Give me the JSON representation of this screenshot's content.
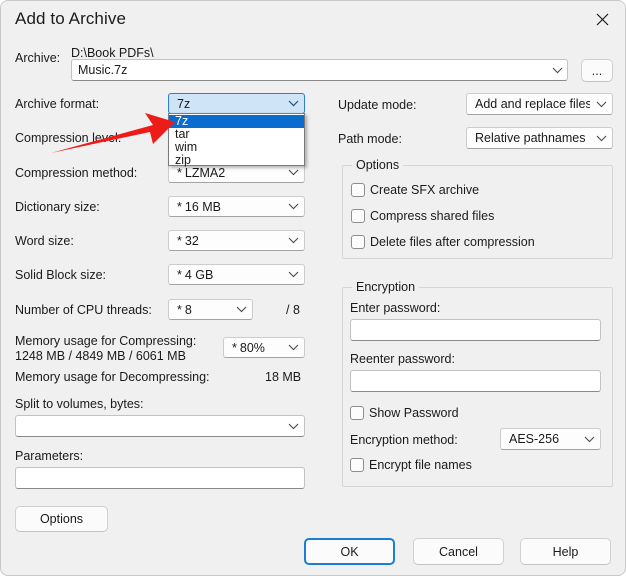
{
  "window": {
    "title": "Add to Archive",
    "close_icon": "close-icon"
  },
  "archive": {
    "label": "Archive:",
    "path": "D:\\Book PDFs\\",
    "filename": "Music.7z",
    "browse_label": "...",
    "dropdown_icon": "chevron-down-icon"
  },
  "left": {
    "archive_format": {
      "label": "Archive format:",
      "value": "7z",
      "open": true,
      "options": [
        "7z",
        "tar",
        "wim",
        "zip"
      ],
      "selected_index": 0
    },
    "compression_level": {
      "label": "Compression level:",
      "value": ""
    },
    "compression_method": {
      "label": "Compression method:",
      "star": "*",
      "value": "LZMA2"
    },
    "dictionary_size": {
      "label": "Dictionary size:",
      "star": "*",
      "value": "16 MB"
    },
    "word_size": {
      "label": "Word size:",
      "star": "*",
      "value": "32"
    },
    "solid_block_size": {
      "label": "Solid Block size:",
      "star": "*",
      "value": "4 GB"
    },
    "cpu_threads": {
      "label": "Number of CPU threads:",
      "star": "*",
      "value": "8",
      "total": "/ 8"
    },
    "memory_compressing": {
      "label": "Memory usage for Compressing:",
      "detail": "1248 MB / 4849 MB / 6061 MB",
      "star": "*",
      "percent": "80%"
    },
    "memory_decompressing": {
      "label": "Memory usage for Decompressing:",
      "value": "18 MB"
    },
    "split_volumes": {
      "label": "Split to volumes, bytes:",
      "value": ""
    },
    "parameters": {
      "label": "Parameters:",
      "value": ""
    },
    "options_button": "Options"
  },
  "right": {
    "update_mode": {
      "label": "Update mode:",
      "value": "Add and replace files"
    },
    "path_mode": {
      "label": "Path mode:",
      "value": "Relative pathnames"
    },
    "options_group": {
      "title": "Options",
      "checkboxes": [
        {
          "label": "Create SFX archive",
          "checked": false
        },
        {
          "label": "Compress shared files",
          "checked": false
        },
        {
          "label": "Delete files after compression",
          "checked": false
        }
      ]
    },
    "encryption_group": {
      "title": "Encryption",
      "enter_password_label": "Enter password:",
      "enter_password_value": "",
      "reenter_password_label": "Reenter password:",
      "reenter_password_value": "",
      "show_password": {
        "label": "Show Password",
        "checked": false
      },
      "encryption_method_label": "Encryption method:",
      "encryption_method_value": "AES-256",
      "encrypt_file_names": {
        "label": "Encrypt file names",
        "checked": false
      }
    }
  },
  "footer": {
    "ok": "OK",
    "cancel": "Cancel",
    "help": "Help"
  },
  "annotation": {
    "arrow_color": "#ee1c18",
    "description": "red-arrow-pointing-to-archive-format-dropdown"
  }
}
